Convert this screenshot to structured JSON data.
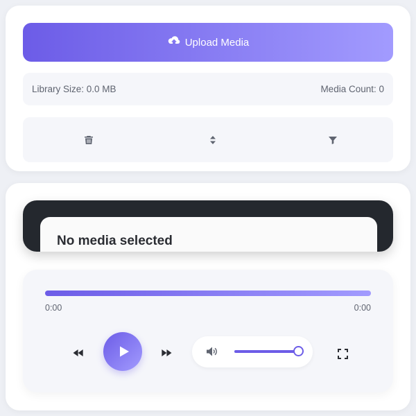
{
  "library": {
    "upload_label": "Upload Media",
    "library_size_text": "Library Size: 0.0 MB",
    "media_count_text": "Media Count: 0",
    "toolbar": {
      "icons": [
        "trash-icon",
        "sort-icon",
        "filter-icon"
      ]
    }
  },
  "player": {
    "now_playing_title": "No media selected",
    "current_time": "0:00",
    "total_time": "0:00",
    "progress": 1.0,
    "volume": 1.0,
    "controls": [
      "rewind-icon",
      "play-icon",
      "fast-forward-icon",
      "volume-icon",
      "fullscreen-icon"
    ]
  },
  "colors": {
    "accent_start": "#6c5ce7",
    "accent_end": "#a29bfe",
    "viewer_dark": "#24282e",
    "panel_bg": "#f5f6fa"
  }
}
